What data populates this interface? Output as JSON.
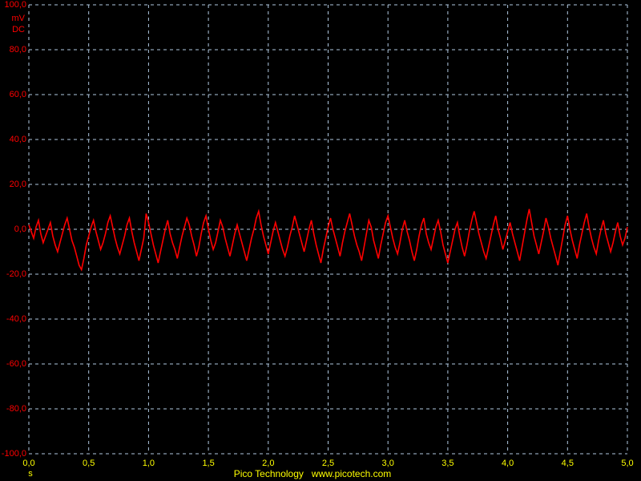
{
  "colors": {
    "background": "#000000",
    "grid": "#b0c8e0",
    "trace": "#ff0000",
    "y_axis_text": "#ff0000",
    "x_axis_text": "#ffff00",
    "footer_text": "#ffff00"
  },
  "y_axis": {
    "tick_labels": [
      "100,0",
      "80,0",
      "60,0",
      "40,0",
      "20,0",
      "0,0",
      "-20,0",
      "-40,0",
      "-60,0",
      "-80,0",
      "-100,0"
    ],
    "unit_line1": "mV",
    "unit_line2": "DC"
  },
  "x_axis": {
    "tick_labels": [
      "0,0",
      "0,5",
      "1,0",
      "1,5",
      "2,0",
      "2,5",
      "3,0",
      "3,5",
      "4,0",
      "4,5",
      "5,0"
    ],
    "unit": "s"
  },
  "footer": {
    "brand": "Pico Technology",
    "url": "www.picotech.com"
  },
  "chart_data": {
    "type": "line",
    "title": "",
    "xlabel": "s",
    "ylabel": "mV DC",
    "xlim": [
      0,
      5
    ],
    "ylim": [
      -100,
      100
    ],
    "x_ticks": [
      0.0,
      0.5,
      1.0,
      1.5,
      2.0,
      2.5,
      3.0,
      3.5,
      4.0,
      4.5,
      5.0
    ],
    "y_ticks": [
      100,
      80,
      60,
      40,
      20,
      0,
      -20,
      -40,
      -60,
      -80,
      -100
    ],
    "grid": true,
    "legend": false,
    "series": [
      {
        "name": "trace",
        "x_start": 0,
        "x_step": 0.02,
        "values": [
          2,
          -1,
          -4,
          1,
          4,
          -2,
          -6,
          -3,
          0,
          3,
          -3,
          -7,
          -10,
          -6,
          -2,
          2,
          5,
          0,
          -5,
          -8,
          -12,
          -16,
          -18,
          -13,
          -7,
          -3,
          1,
          4,
          -1,
          -5,
          -9,
          -6,
          -2,
          3,
          6,
          1,
          -4,
          -8,
          -11,
          -7,
          -3,
          2,
          5,
          -1,
          -6,
          -10,
          -14,
          -9,
          -4,
          7,
          3,
          -2,
          -7,
          -11,
          -15,
          -10,
          -5,
          0,
          4,
          -2,
          -6,
          -9,
          -13,
          -8,
          -3,
          1,
          5,
          2,
          -3,
          -7,
          -12,
          -8,
          -2,
          3,
          6,
          0,
          -5,
          -9,
          -6,
          -1,
          4,
          1,
          -4,
          -8,
          -12,
          -7,
          -2,
          2,
          -2,
          -6,
          -10,
          -14,
          -9,
          -4,
          0,
          5,
          8,
          2,
          -3,
          -7,
          -11,
          -6,
          -1,
          3,
          -1,
          -5,
          -9,
          -12,
          -8,
          -3,
          1,
          6,
          2,
          -2,
          -6,
          -10,
          -5,
          0,
          4,
          -2,
          -7,
          -11,
          -15,
          -9,
          -4,
          1,
          5,
          0,
          -4,
          -8,
          -12,
          -6,
          -1,
          3,
          7,
          2,
          -3,
          -7,
          -10,
          -14,
          -8,
          -2,
          4,
          1,
          -5,
          -9,
          -13,
          -7,
          -2,
          3,
          6,
          1,
          -4,
          -8,
          -11,
          -6,
          0,
          4,
          -1,
          -5,
          -10,
          -14,
          -9,
          -3,
          2,
          5,
          -2,
          -6,
          -9,
          -4,
          1,
          4,
          -1,
          -7,
          -11,
          -15,
          -10,
          -5,
          0,
          3,
          -3,
          -8,
          -12,
          -7,
          -1,
          4,
          8,
          3,
          -2,
          -6,
          -10,
          -13,
          -8,
          -3,
          2,
          6,
          0,
          -4,
          -9,
          -5,
          -1,
          3,
          -2,
          -6,
          -10,
          -14,
          -8,
          -2,
          4,
          9,
          3,
          -3,
          -7,
          -11,
          -6,
          -1,
          5,
          1,
          -4,
          -8,
          -12,
          -16,
          -10,
          -4,
          2,
          6,
          0,
          -5,
          -9,
          -13,
          -7,
          -2,
          3,
          7,
          1,
          -4,
          -8,
          -11,
          -5,
          0,
          4,
          -2,
          -6,
          -10,
          -6,
          -1,
          3,
          -3,
          -7,
          -4,
          1
        ]
      }
    ]
  }
}
